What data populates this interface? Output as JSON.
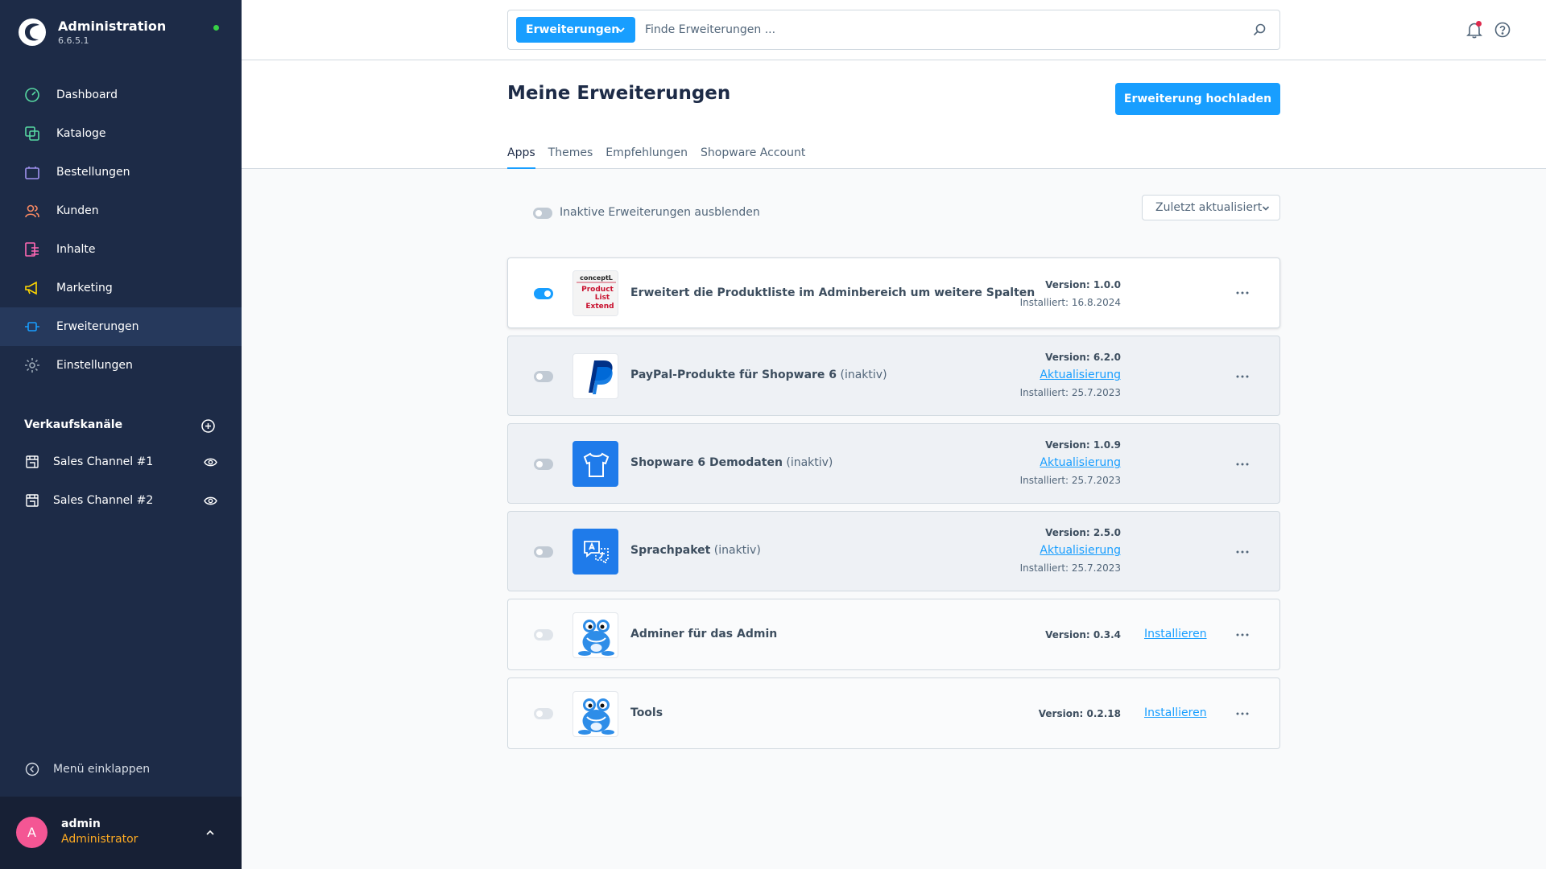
{
  "app": {
    "title": "Administration",
    "version": "6.6.5.1"
  },
  "nav": [
    {
      "label": "Dashboard",
      "icon": "dashboard-icon",
      "color": "#57d9a3"
    },
    {
      "label": "Kataloge",
      "icon": "catalog-icon",
      "color": "#57d9a3"
    },
    {
      "label": "Bestellungen",
      "icon": "orders-icon",
      "color": "#a092f0"
    },
    {
      "label": "Kunden",
      "icon": "customers-icon",
      "color": "#f88962"
    },
    {
      "label": "Inhalte",
      "icon": "content-icon",
      "color": "#ff68b4"
    },
    {
      "label": "Marketing",
      "icon": "marketing-icon",
      "color": "#ffd700"
    },
    {
      "label": "Erweiterungen",
      "icon": "extensions-icon",
      "color": "#189eff"
    },
    {
      "label": "Einstellungen",
      "icon": "settings-icon",
      "color": "#9aa8b5"
    }
  ],
  "sales_channels": {
    "title": "Verkaufskanäle",
    "items": [
      {
        "label": "Sales Channel #1"
      },
      {
        "label": "Sales Channel #2"
      }
    ]
  },
  "collapse_label": "Menü einklappen",
  "user": {
    "initial": "A",
    "name": "admin",
    "role": "Administrator"
  },
  "search": {
    "type_label": "Erweiterungen",
    "placeholder": "Finde Erweiterungen ..."
  },
  "page": {
    "title": "Meine Erweiterungen",
    "upload_label": "Erweiterung hochladen",
    "tabs": [
      "Apps",
      "Themes",
      "Empfehlungen",
      "Shopware Account"
    ],
    "active_tab": "Apps"
  },
  "filter": {
    "toggle_label": "Inaktive Erweiterungen ausblenden",
    "sort_label": "Zuletzt aktualisiert"
  },
  "extensions": [
    {
      "name": "Erweitert die Produktliste im Adminbereich um weitere Spalten",
      "suffix": "",
      "version": "Version: 1.0.0",
      "installed": "Installiert: 16.8.2024",
      "action": "",
      "state": "active",
      "icon": "product-list-extend-icon",
      "icon_text": [
        "conceptL",
        "Product",
        "List",
        "Extend"
      ]
    },
    {
      "name": "PayPal-Produkte für Shopware 6",
      "suffix": " (inaktiv)",
      "version": "Version: 6.2.0",
      "installed": "Installiert: 25.7.2023",
      "action": "Aktualisierung",
      "state": "inactive",
      "icon": "paypal-icon"
    },
    {
      "name": "Shopware 6 Demodaten",
      "suffix": " (inaktiv)",
      "version": "Version: 1.0.9",
      "installed": "Installiert: 25.7.2023",
      "action": "Aktualisierung",
      "state": "inactive",
      "icon": "tshirt-icon"
    },
    {
      "name": "Sprachpaket",
      "suffix": " (inaktiv)",
      "version": "Version: 2.5.0",
      "installed": "Installiert: 25.7.2023",
      "action": "Aktualisierung",
      "state": "inactive",
      "icon": "language-icon"
    },
    {
      "name": "Adminer für das Admin",
      "suffix": "",
      "version": "Version: 0.3.4",
      "installed": "",
      "action": "Installieren",
      "state": "not-installed",
      "icon": "frog-icon"
    },
    {
      "name": "Tools",
      "suffix": "",
      "version": "Version: 0.2.18",
      "installed": "",
      "action": "Installieren",
      "state": "not-installed",
      "icon": "frog-icon"
    }
  ]
}
